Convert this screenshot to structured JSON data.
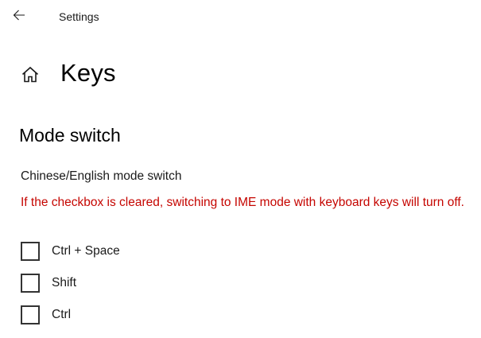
{
  "titlebar": {
    "back_icon": "back-arrow-icon",
    "app_title": "Settings"
  },
  "header": {
    "home_icon": "home-icon",
    "page_title": "Keys"
  },
  "section": {
    "title": "Mode switch",
    "group_label": "Chinese/English mode switch",
    "warning": "If the checkbox is cleared, switching to IME mode with keyboard keys will turn off.",
    "warning_color": "#c50500"
  },
  "checkboxes": [
    {
      "label": "Ctrl + Space",
      "checked": false
    },
    {
      "label": "Shift",
      "checked": false
    },
    {
      "label": "Ctrl",
      "checked": false
    }
  ]
}
